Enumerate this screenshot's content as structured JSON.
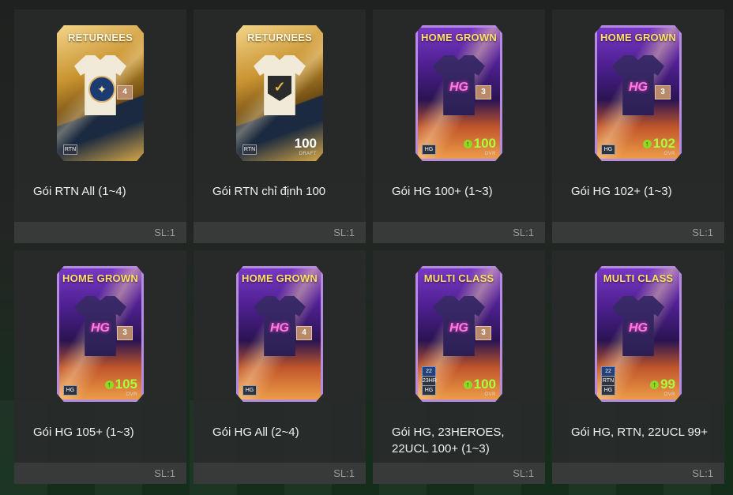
{
  "packs": [
    {
      "name": "Gói RTN All (1~4)",
      "count": "SL:1",
      "card": {
        "style": "rtn",
        "title": "RETURNEES",
        "grade": "4",
        "tags": [
          "RTN"
        ],
        "ovr": "",
        "ovr_label": ""
      }
    },
    {
      "name": "Gói RTN chỉ định 100",
      "count": "SL:1",
      "card": {
        "style": "rtn",
        "title": "RETURNEES",
        "grade": "",
        "tags": [
          "RTN"
        ],
        "ovr": "100",
        "ovr_label": "DRAFT"
      }
    },
    {
      "name": "Gói HG 100+ (1~3)",
      "count": "SL:1",
      "card": {
        "style": "hg",
        "title": "HOME GROWN",
        "grade": "3",
        "tags": [
          "HG"
        ],
        "ovr": "100",
        "ovr_label": "OVR"
      }
    },
    {
      "name": "Gói HG 102+ (1~3)",
      "count": "SL:1",
      "card": {
        "style": "hg",
        "title": "HOME GROWN",
        "grade": "3",
        "tags": [
          "HG"
        ],
        "ovr": "102",
        "ovr_label": "OVR"
      }
    },
    {
      "name": "Gói HG 105+ (1~3)",
      "count": "SL:1",
      "card": {
        "style": "hg",
        "title": "HOME GROWN",
        "grade": "3",
        "tags": [
          "HG"
        ],
        "ovr": "105",
        "ovr_label": "OVR"
      }
    },
    {
      "name": "Gói HG All (2~4)",
      "count": "SL:1",
      "card": {
        "style": "hg",
        "title": "HOME GROWN",
        "grade": "4",
        "tags": [
          "HG"
        ],
        "ovr": "",
        "ovr_label": ""
      }
    },
    {
      "name": "Gói HG, 23HEROES, 22UCL 100+ (1~3)",
      "count": "SL:1",
      "card": {
        "style": "hg",
        "title": "MULTI CLASS",
        "grade": "3",
        "tags": [
          "22",
          "23HR",
          "HG"
        ],
        "ovr": "100",
        "ovr_label": "OVR"
      }
    },
    {
      "name": "Gói HG, RTN, 22UCL 99+",
      "count": "SL:1",
      "card": {
        "style": "hg",
        "title": "MULTI CLASS",
        "grade": "",
        "tags": [
          "22",
          "RTN",
          "HG"
        ],
        "ovr": "99",
        "ovr_label": "OVR"
      }
    }
  ],
  "icons": {
    "ovr_up": "arrow-up-icon",
    "emblem_rtn": "star-crest-icon",
    "emblem_check": "check-shield-icon",
    "hg_logo": "hg-logo-icon"
  },
  "colors": {
    "ovr_green": "#a8ff3a",
    "hg_purple": "#7a39c9",
    "rtn_gold": "#c99330"
  }
}
